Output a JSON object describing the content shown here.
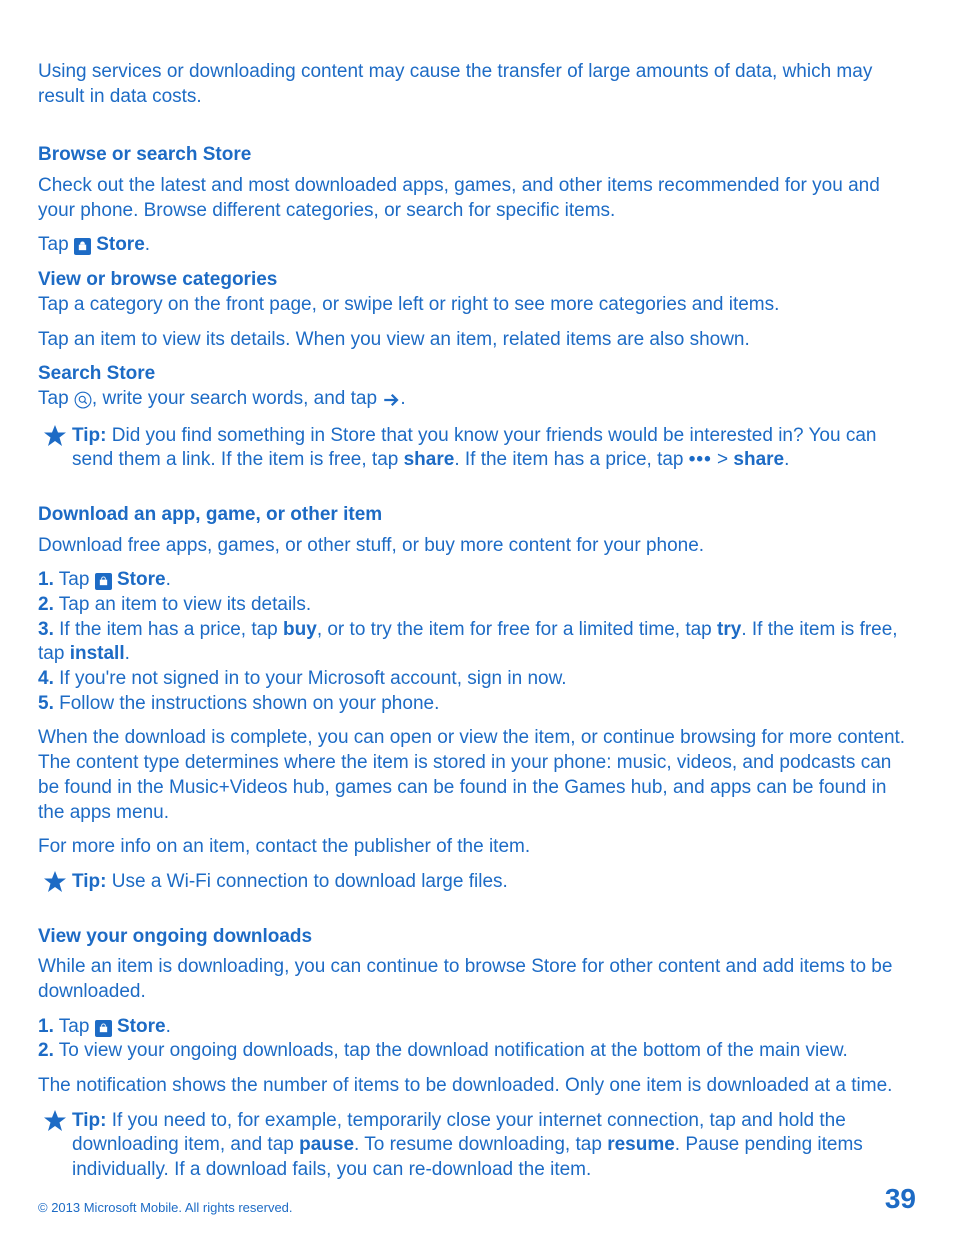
{
  "intro": "Using services or downloading content may cause the transfer of large amounts of data, which may result in data costs.",
  "browse": {
    "heading": "Browse or search Store",
    "desc": "Check out the latest and most downloaded apps, games, and other items recommended for you and your phone. Browse different categories, or search for specific items.",
    "tap_prefix": "Tap ",
    "tap_suffix": ".",
    "store_label": "Store"
  },
  "view_cat": {
    "heading": "View or browse categories",
    "line1": "Tap a category on the front page, or swipe left or right to see more categories and items.",
    "line2": "Tap an item to view its details. When you view an item, related items are also shown."
  },
  "search": {
    "heading": "Search Store",
    "line_prefix": "Tap ",
    "line_mid": ", write your search words, and tap ",
    "line_suffix": "."
  },
  "tip1": {
    "tip_label": "Tip:",
    "t1": " Did you find something in Store that you know your friends would be interested in? You can send them a link. If the item is free, tap ",
    "share1": "share",
    "t2": ". If the item has a price, tap  ",
    "dots": "•••",
    "gt": "  > ",
    "share2": "share",
    "t3": "."
  },
  "download": {
    "heading": "Download an app, game, or other item",
    "desc": "Download free apps, games, or other stuff, or buy more content for your phone.",
    "n1": "1.",
    "s1a": " Tap ",
    "s1b": ".",
    "n2": "2.",
    "s2": " Tap an item to view its details.",
    "n3": "3.",
    "s3a": " If the item has a price, tap ",
    "buy": "buy",
    "s3b": ", or to try the item for free for a limited time, tap ",
    "try": "try",
    "s3c": ". If the item is free, tap ",
    "install": "install",
    "s3d": ".",
    "n4": "4.",
    "s4": " If you're not signed in to your Microsoft account, sign in now.",
    "n5": "5.",
    "s5": " Follow the instructions shown on your phone.",
    "after1": "When the download is complete, you can open or view the item, or continue browsing for more content. The content type determines where the item is stored in your phone: music, videos, and podcasts can be found in the Music+Videos hub, games can be found in the Games hub, and apps can be found in the apps menu.",
    "after2": "For more info on an item, contact the publisher of the item."
  },
  "tip2": {
    "tip_label": "Tip:",
    "text": " Use a Wi-Fi connection to download large files."
  },
  "ongoing": {
    "heading": "View your ongoing downloads",
    "desc": "While an item is downloading, you can continue to browse Store for other content and add items to be downloaded.",
    "n1": "1.",
    "s1a": " Tap ",
    "s1b": ".",
    "n2": "2.",
    "s2": " To view your ongoing downloads, tap the download notification at the bottom of the main view.",
    "note": "The notification shows the number of items to be downloaded. Only one item is downloaded at a time."
  },
  "tip3": {
    "tip_label": "Tip:",
    "t1": " If you need to, for example, temporarily close your internet connection, tap and hold the downloading item, and tap ",
    "pause": "pause",
    "t2": ". To resume downloading, tap ",
    "resume": "resume",
    "t3": ". Pause pending items individually. If a download fails, you can re-download the item."
  },
  "store_label": "Store",
  "footer": {
    "copyright": "© 2013 Microsoft Mobile. All rights reserved.",
    "page": "39"
  }
}
